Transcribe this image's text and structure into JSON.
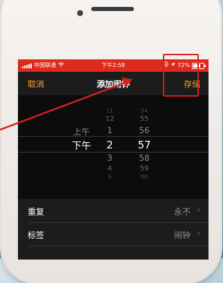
{
  "status_bar": {
    "carrier": "中国联通",
    "time": "下午2:58",
    "battery_percent": "72%",
    "battery_level": 0.72,
    "color": "#de2a1d"
  },
  "nav": {
    "cancel_label": "取消",
    "title": "添加闹钟",
    "save_label": "存储",
    "accent_color": "#ff9d2a"
  },
  "picker": {
    "ampm": [
      "上午",
      "下午"
    ],
    "ampm_selected": "下午",
    "hours": [
      "11",
      "12",
      "1",
      "2",
      "3",
      "4",
      "5"
    ],
    "hour_selected": "2",
    "minutes": [
      "54",
      "55",
      "56",
      "57",
      "58",
      "59",
      "00"
    ],
    "minute_selected": "57"
  },
  "options": [
    {
      "label": "重复",
      "value": "永不"
    },
    {
      "label": "标签",
      "value": "闹钟"
    }
  ],
  "annotation": {
    "highlight_color": "#d81e1e"
  },
  "icons": {
    "wifi": "wifi-icon",
    "location": "location-icon",
    "lock_rotation": "rotation-lock-icon",
    "battery": "battery-icon",
    "chevron": "chevron-right-icon"
  }
}
